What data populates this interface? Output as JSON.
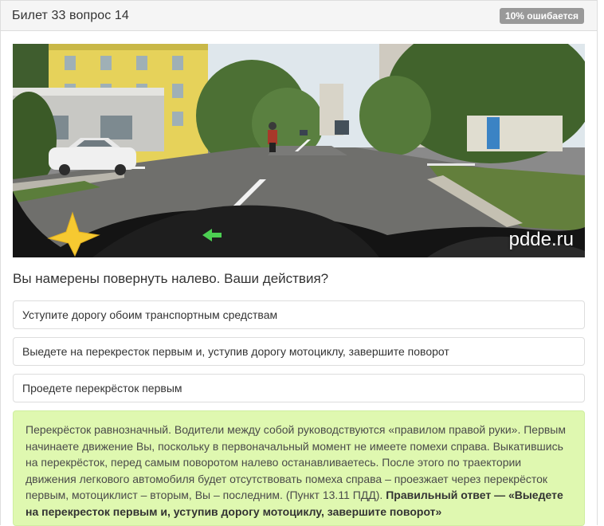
{
  "header": {
    "title": "Билет 33 вопрос 14",
    "badge": "10% ошибается"
  },
  "image": {
    "watermark": "pdde.ru"
  },
  "question": "Вы намерены повернуть налево. Ваши действия?",
  "answers": [
    {
      "label": "Уступите дорогу обоим транспортным средствам"
    },
    {
      "label": "Выедете на перекресток первым и, уступив дорогу мотоциклу, завершите поворот"
    },
    {
      "label": "Проедете перекрёсток первым"
    }
  ],
  "explanation": {
    "text": "Перекрёсток равнозначный. Водители между собой руководствуются «правилом правой руки». Первым начинаете движение Вы, поскольку в первоначальный момент не имеете помехи справа. Выкатившись на перекрёсток, перед самым поворотом налево останавливаетесь. После этого по траектории движения легкового автомобиля будет отсутствовать помеха справа – проезжает через перекрёсток первым, мотоциклист – вторым, Вы – последним. (Пункт 13.11 ПДД). ",
    "correct": "Правильный ответ — «Выедете на перекресток первым и, уступив дорогу мотоциклу, завершите поворот»"
  },
  "colors": {
    "header_bg": "#f5f5f5",
    "badge_bg": "#999999",
    "explanation_bg": "#dff8b0"
  }
}
